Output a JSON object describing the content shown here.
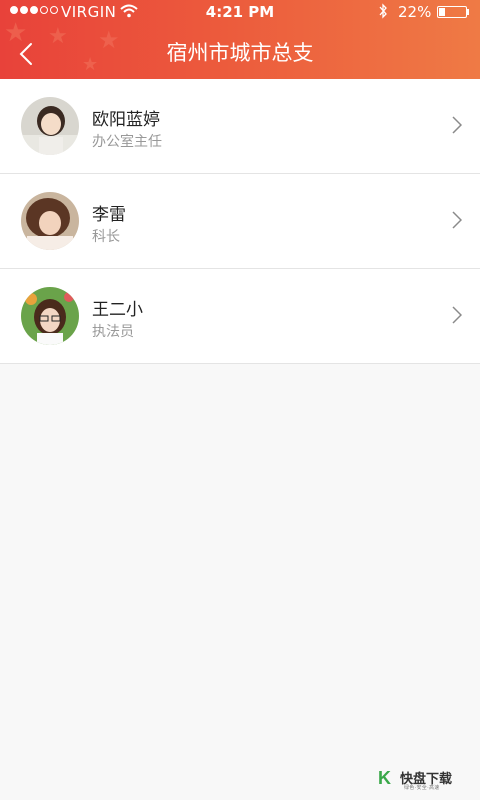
{
  "status_bar": {
    "carrier": "VIRGIN",
    "time": "4:21 PM",
    "battery_percent": "22%",
    "battery_level": 0.22
  },
  "header": {
    "title": "宿州市城市总支",
    "back_icon": "chevron-left-icon"
  },
  "contacts": [
    {
      "name": "欧阳蓝婷",
      "role": "办公室主任"
    },
    {
      "name": "李雷",
      "role": "科长"
    },
    {
      "name": "王二小",
      "role": "执法员"
    }
  ],
  "colors": {
    "header_start": "#e8423a",
    "header_end": "#ef7a45",
    "name_text": "#222222",
    "role_text": "#999999"
  },
  "watermark": {
    "logo_text": "快盘下载",
    "sub_text": "绿色·安全·高速"
  }
}
